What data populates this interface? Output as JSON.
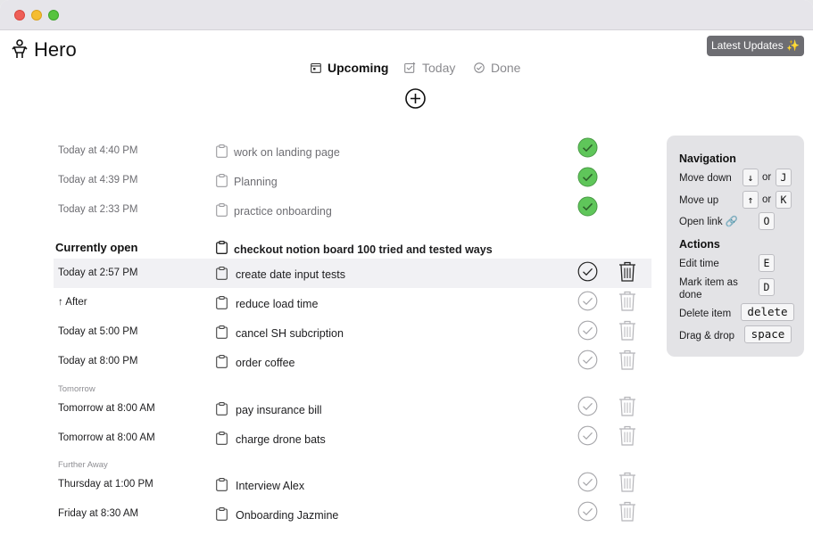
{
  "app": {
    "title": "Hero"
  },
  "header": {
    "updates_label": "Latest Updates ✨"
  },
  "tabs": [
    {
      "label": "Upcoming",
      "icon": "calendar-icon",
      "active": true
    },
    {
      "label": "Today",
      "icon": "calendar-today-icon",
      "active": false
    },
    {
      "label": "Done",
      "icon": "check-circle-icon",
      "active": false
    }
  ],
  "done_items": [
    {
      "time": "Today at 4:40 PM",
      "task": "work on landing page"
    },
    {
      "time": "Today at 4:39 PM",
      "task": "Planning"
    },
    {
      "time": "Today at 2:33 PM",
      "task": "practice onboarding"
    }
  ],
  "current": {
    "heading": "Currently open",
    "task": "checkout notion board 100 tried and tested ways"
  },
  "groups": {
    "tomorrow": "Tomorrow",
    "further": "Further Away"
  },
  "items": [
    {
      "time": "Today at 2:57 PM",
      "task": "create date input tests"
    },
    {
      "time": "↑ After",
      "task": "reduce load time"
    },
    {
      "time": "Today at 5:00 PM",
      "task": "cancel SH subcription"
    },
    {
      "time": "Today at 8:00 PM",
      "task": "order coffee"
    },
    {
      "time": "Tomorrow at 8:00 AM",
      "task": "pay insurance bill"
    },
    {
      "time": "Tomorrow at 8:00 AM",
      "task": "charge drone bats"
    },
    {
      "time": "Thursday at 1:00 PM",
      "task": "Interview Alex"
    },
    {
      "time": "Friday at 8:30 AM",
      "task": "Onboarding Jazmine"
    }
  ],
  "shortcuts": {
    "navigation_heading": "Navigation",
    "actions_heading": "Actions",
    "or": "or",
    "move_down": {
      "label": "Move down",
      "key1": "↓",
      "key2": "J"
    },
    "move_up": {
      "label": "Move up",
      "key1": "↑",
      "key2": "K"
    },
    "open_link": {
      "label": "Open link 🔗",
      "key": "O"
    },
    "edit_time": {
      "label": "Edit time",
      "key": "E"
    },
    "mark_done": {
      "label": "Mark item as done",
      "key": "D"
    },
    "delete_item": {
      "label": "Delete item",
      "key": "delete"
    },
    "drag_drop": {
      "label": "Drag & drop",
      "key": "space"
    }
  },
  "colors": {
    "done_green": "#5fc65a",
    "accent_dark": "#6d6d72"
  }
}
